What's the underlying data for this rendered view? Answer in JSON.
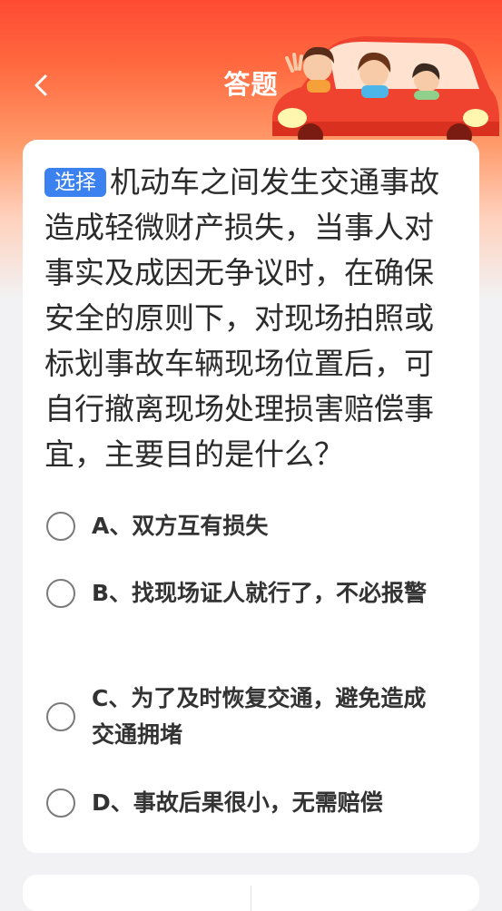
{
  "header": {
    "title": "答题",
    "back_icon": "chevron-left-icon",
    "decoration": "family-car-illustration"
  },
  "question": {
    "type_tag": "选择",
    "text": "机动车之间发生交通事故造成轻微财产损失，当事人对事实及成因无争议时，在确保安全的原则下，对现场拍照或标划事故车辆现场位置后，可自行撤离现场处理损害赔偿事宜，主要目的是什么？"
  },
  "options": [
    {
      "label": "A、双方互有损失"
    },
    {
      "label": "B、找现场证人就行了，不必报警"
    },
    {
      "label": "C、为了及时恢复交通，避免造成交通拥堵"
    },
    {
      "label": "D、事故后果很小，无需赔偿"
    }
  ],
  "colors": {
    "header_red": "#ff4a33",
    "tag_blue": "#3b82f0"
  }
}
